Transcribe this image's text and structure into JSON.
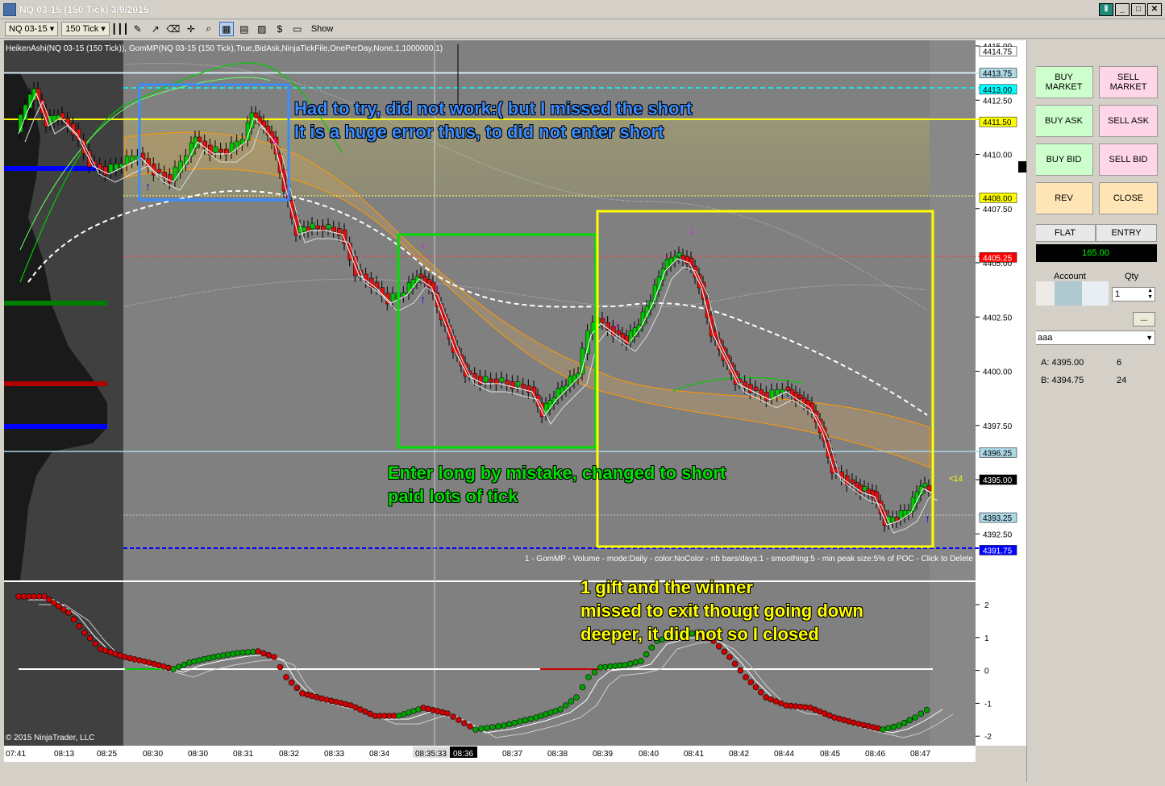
{
  "window": {
    "title": "NQ 03-15 (150 Tick)  3/9/2015"
  },
  "toolbar": {
    "instrument": "NQ 03-15",
    "interval": "150 Tick",
    "show_label": "Show"
  },
  "chart": {
    "indicator_header": "HeikenAshi(NQ 03-15 (150 Tick)), GomMP(NQ 03-15 (150 Tick),True,BidAsk,NinjaTickFile,OnePerDay,None,1,1000000,1)",
    "gom_footer": "1 - GomMP - Volume - mode:Daily  - color:NoColor - nb bars/days:1 - smoothing:5 - min peak size:5% of POC - Click to Delete",
    "copyright": "© 2015 NinjaTrader, LLC",
    "price_labels": [
      "4415.00",
      "4412.50",
      "4410.00",
      "4407.50",
      "4405.00",
      "4402.50",
      "4400.00",
      "4397.50",
      "4395.00",
      "4392.50"
    ],
    "price_tags": [
      {
        "text": "4414.75",
        "bg": "#ffffff",
        "fg": "#000000"
      },
      {
        "text": "4413.75",
        "bg": "#add8e6",
        "fg": "#000000"
      },
      {
        "text": "4413.00",
        "bg": "#00ffff",
        "fg": "#000000"
      },
      {
        "text": "4411.50",
        "bg": "#ffff00",
        "fg": "#000000"
      },
      {
        "text": "4408.00",
        "bg": "#ffff00",
        "fg": "#000000"
      },
      {
        "text": "4405.25",
        "bg": "#ff0000",
        "fg": "#ffffff"
      },
      {
        "text": "4396.25",
        "bg": "#add8e6",
        "fg": "#000000"
      },
      {
        "text": "4395.00",
        "bg": "#000000",
        "fg": "#ffffff"
      },
      {
        "text": "4393.25",
        "bg": "#add8e6",
        "fg": "#000000"
      },
      {
        "text": "4391.75",
        "bg": "#0000ff",
        "fg": "#ffffff"
      }
    ],
    "osc_labels": [
      "2",
      "1",
      "0",
      "-1",
      "-2"
    ],
    "time_labels": [
      "07:41",
      "08:13",
      "08:25",
      "08:30",
      "08:30",
      "08:31",
      "08:32",
      "08:33",
      "08:34",
      "08:35:33",
      "08:36",
      "08:37",
      "08:38",
      "08:39",
      "08:40",
      "08:41",
      "08:42",
      "08:44",
      "08:45",
      "08:46",
      "08:47"
    ],
    "small_tag": "<14",
    "annotations": {
      "blue_line1": "Had to try, did not work:( but I missed the short",
      "blue_line2": "It is a huge error thus, to did not enter short",
      "green_line1": "Enter long by mistake, changed to short",
      "green_line2": "paid lots of tick",
      "yellow_line1": "1 gift and the winner",
      "yellow_line2": "missed to exit thougt going down",
      "yellow_line3": "deeper, it did not so I closed"
    },
    "colors": {
      "bg": "#808080",
      "up": "#00c800",
      "down": "#e01010",
      "blue_annot": "#3a8cff",
      "green_annot": "#00e000",
      "yellow_annot": "#ffff00"
    }
  },
  "order_panel": {
    "buy_market": "BUY\nMARKET",
    "sell_market": "SELL\nMARKET",
    "buy_ask": "BUY ASK",
    "sell_ask": "SELL ASK",
    "buy_bid": "BUY BID",
    "sell_bid": "SELL BID",
    "rev": "REV",
    "close": "CLOSE",
    "flat": "FLAT",
    "entry": "ENTRY",
    "pos_value": "165.00",
    "account_label": "Account",
    "qty_label": "Qty",
    "qty_value": "1",
    "browse": "...",
    "strategy": "aaa",
    "ask_label": "A: 4395.00",
    "ask_size": "6",
    "bid_label": "B: 4394.75",
    "bid_size": "24"
  }
}
